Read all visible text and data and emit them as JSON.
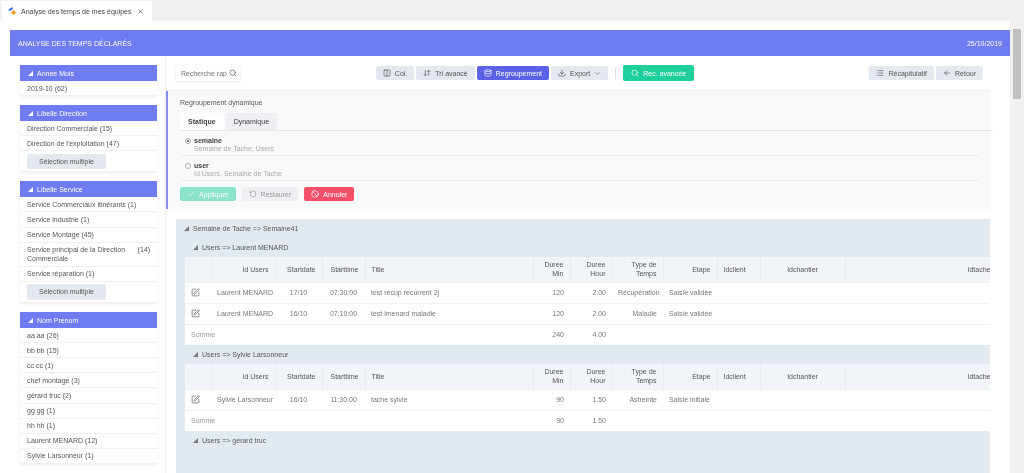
{
  "browser_tab": {
    "title": "Analyse des temps de mes équipes"
  },
  "header": {
    "title": "ANALYSE DES TEMPS DÉCLARÉS",
    "date": "25/10/2019"
  },
  "filters": [
    {
      "title": "Annee Mois",
      "items": [
        {
          "label": "2019-10 (62)"
        }
      ]
    },
    {
      "title": "Libelle Direction",
      "items": [
        {
          "label": "Direction Commerciale (15)"
        },
        {
          "label": "Direction de l'exploitation (47)"
        }
      ],
      "button": "Sélection multiple"
    },
    {
      "title": "Libelle Service",
      "items": [
        {
          "label": "Service Commerciaux itinérants (1)"
        },
        {
          "label": "Service industrie (1)"
        },
        {
          "label": "Service Montage (45)"
        },
        {
          "label": "Service principal de la Direction Commerciale",
          "count": "(14)"
        },
        {
          "label": "Service réparation (1)"
        }
      ],
      "button": "Sélection multiple"
    },
    {
      "title": "Nom Prenom",
      "items": [
        {
          "label": "aa aa (26)"
        },
        {
          "label": "bb bb (15)"
        },
        {
          "label": "cc cc (1)"
        },
        {
          "label": "chef montage (3)"
        },
        {
          "label": "gérard truc (2)"
        },
        {
          "label": "gg gg (1)"
        },
        {
          "label": "hh hh (1)"
        },
        {
          "label": "Laurent MENARD (12)"
        },
        {
          "label": "Sylvie Larsonneur (1)"
        }
      ]
    }
  ],
  "toolbar": {
    "search": {
      "placeholder": "Recherche rap"
    },
    "buttons": [
      {
        "label": "Col.",
        "kind": "columns",
        "selected": false
      },
      {
        "label": "Tri avancé",
        "kind": "sort",
        "selected": false
      },
      {
        "label": "Regroupement",
        "kind": "grouping",
        "selected": true
      },
      {
        "label": "Export",
        "kind": "export",
        "selected": false
      }
    ],
    "search_button": {
      "label": "Rec. avancée"
    },
    "right_buttons": [
      {
        "label": "Récapitulatif",
        "kind": "summary"
      },
      {
        "label": "Retour",
        "kind": "back"
      }
    ]
  },
  "grouping": {
    "title": "Regroupement dynamique",
    "tabs": [
      {
        "label": "Statique",
        "selected": true
      },
      {
        "label": "Dynamique",
        "selected": false
      }
    ],
    "options": [
      {
        "name": "semaine",
        "fields": "Semaine de Tache, Users",
        "selected": true
      },
      {
        "name": "user",
        "fields": "Id Users, Semaine de Tache",
        "selected": false
      }
    ],
    "actions": [
      {
        "label": "Appliquer",
        "kind": "apply",
        "disabled": true
      },
      {
        "label": "Restaurer",
        "kind": "restore",
        "disabled": true
      },
      {
        "label": "Annuler",
        "kind": "cancel",
        "disabled": false
      }
    ]
  },
  "results": {
    "group": "Semaine de Tache => Semaine41",
    "subgroups": [
      {
        "label": "Users => Laurent MENARD",
        "columns": [
          "Id Users",
          "Startdate",
          "Starttime",
          "Title",
          "Duree Min",
          "Duree Hour",
          "Type de Temps",
          "Etape",
          "Idclient",
          "Idchantier",
          "Idtache"
        ],
        "rows": [
          [
            "Laurent MENARD",
            "17/10",
            "07:30:00",
            "test récup recurrent 2j",
            "120",
            "2.00",
            "Récupération",
            "Saisie validée"
          ],
          [
            "Laurent MENARD",
            "16/10",
            "07:10:00",
            "test lmenard maladie",
            "120",
            "2.00",
            "Maladie",
            "Saisie validée"
          ]
        ],
        "total": {
          "label": "Somme",
          "min": "240",
          "hour": "4.00"
        }
      },
      {
        "label": "Users => Sylvie Larsonneur",
        "columns": [
          "Id Users",
          "Startdate",
          "Starttime",
          "Title",
          "Duree Min",
          "Duree Hour",
          "Type de Temps",
          "Etape",
          "Idclient",
          "Idchantier",
          "Idtache"
        ],
        "rows": [
          [
            "Sylvie Larsonneur",
            "16/10",
            "11:30:00",
            "tache sylvie",
            "90",
            "1.50",
            "Astreinte",
            "Saisie initiale"
          ]
        ],
        "total": {
          "label": "Somme",
          "min": "90",
          "hour": "1.50"
        }
      },
      {
        "label": "Users => gérard truc"
      }
    ]
  }
}
